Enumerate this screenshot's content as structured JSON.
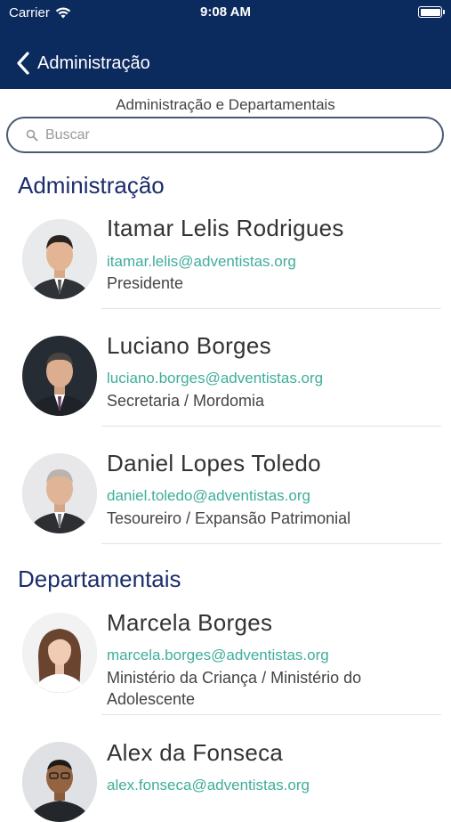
{
  "status_bar": {
    "carrier": "Carrier",
    "time": "9:08 AM"
  },
  "nav": {
    "back_label": "Administração"
  },
  "subtitle": "Administração e Departamentais",
  "search": {
    "placeholder": "Buscar",
    "value": ""
  },
  "sections": [
    {
      "title": "Administração",
      "people": [
        {
          "name": "Itamar Lelis Rodrigues",
          "email": "itamar.lelis@adventistas.org",
          "role": "Presidente"
        },
        {
          "name": "Luciano Borges",
          "email": "luciano.borges@adventistas.org",
          "role": "Secretaria / Mordomia"
        },
        {
          "name": "Daniel Lopes Toledo",
          "email": "daniel.toledo@adventistas.org",
          "role": "Tesoureiro / Expansão Patrimonial"
        }
      ]
    },
    {
      "title": "Departamentais",
      "people": [
        {
          "name": "Marcela Borges",
          "email": "marcela.borges@adventistas.org",
          "role": "Ministério da Criança / Ministério do Adolescente"
        },
        {
          "name": "Alex da Fonseca",
          "email": "alex.fonseca@adventistas.org",
          "role": ""
        }
      ]
    }
  ],
  "colors": {
    "header_bg": "#0b2a5e",
    "section_title": "#1b2d6b",
    "email": "#3fae9a"
  }
}
